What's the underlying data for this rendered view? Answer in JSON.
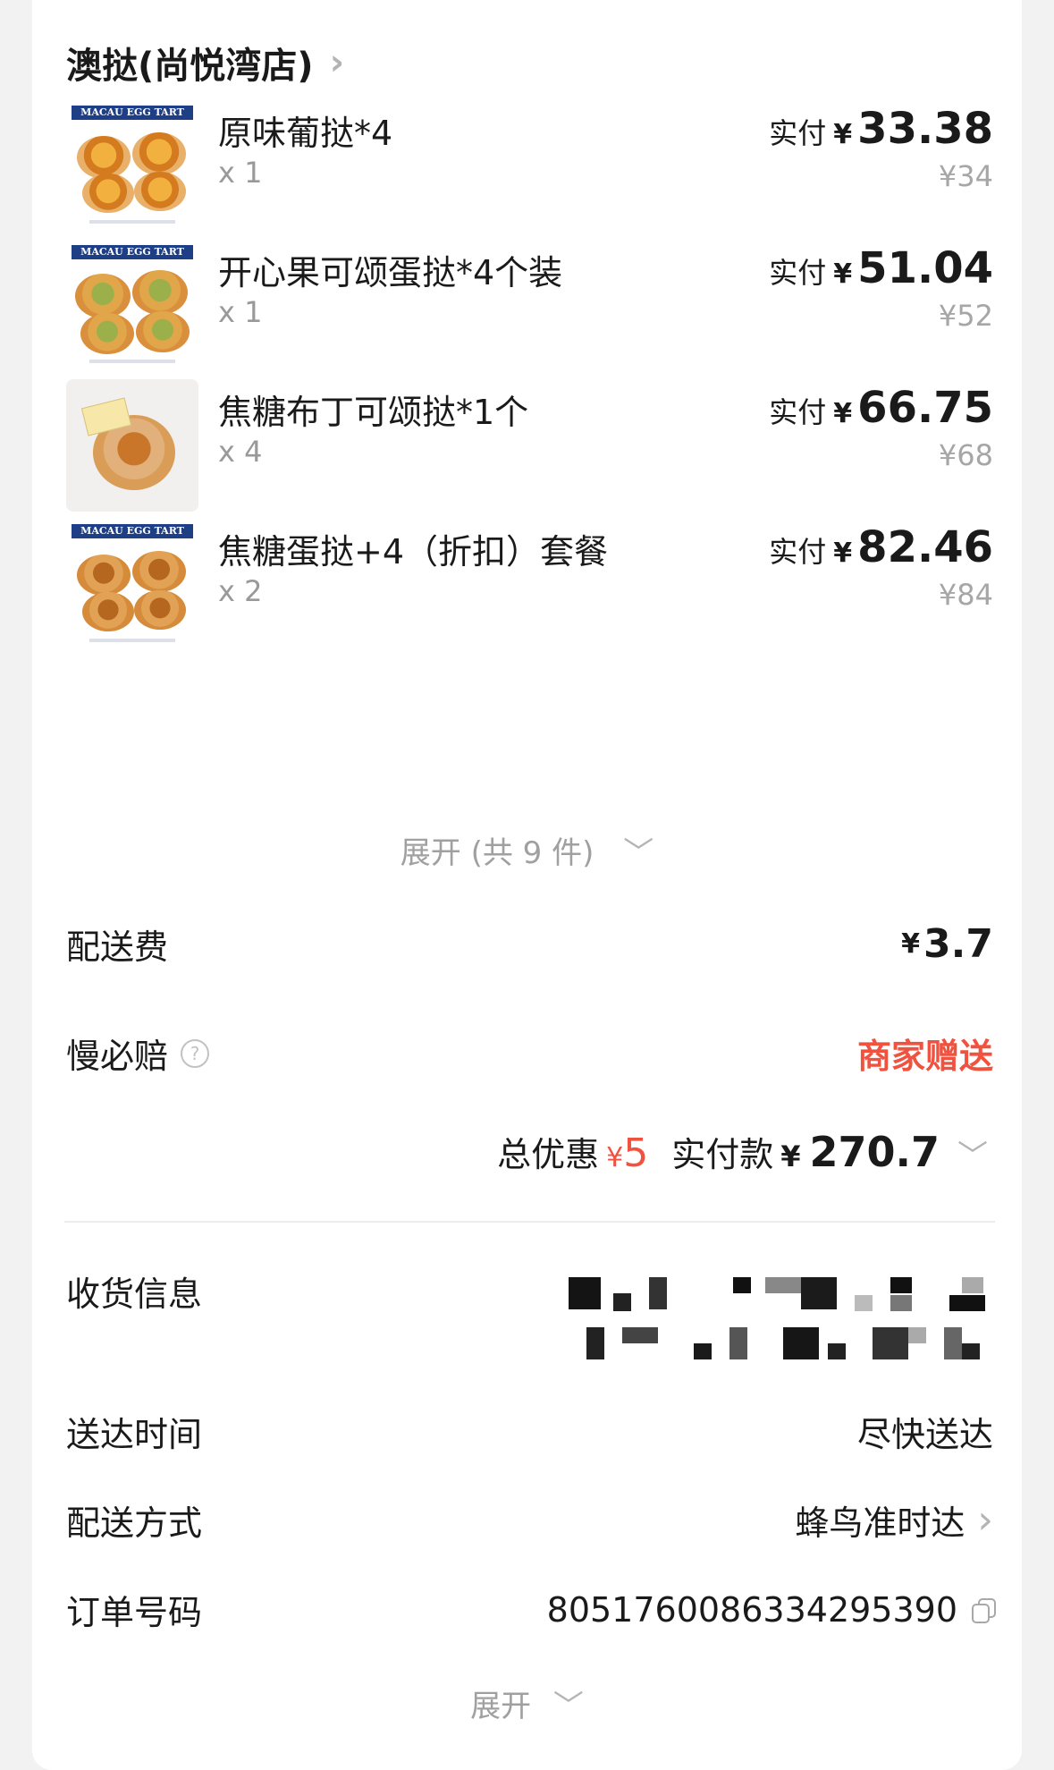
{
  "shop": {
    "name": "澳挞(尚悦湾店)",
    "chevron": "›"
  },
  "items": [
    {
      "thumb_label": "MACAU EGG TART",
      "name": "原味葡挞*4",
      "qty": "x 1",
      "pay_label": "实付",
      "currency": "¥",
      "pay": "33.38",
      "orig": "¥34"
    },
    {
      "thumb_label": "MACAU EGG TART",
      "name": "开心果可颂蛋挞*4个装",
      "qty": "x 1",
      "pay_label": "实付",
      "currency": "¥",
      "pay": "51.04",
      "orig": "¥52"
    },
    {
      "thumb_label": "",
      "name": "焦糖布丁可颂挞*1个",
      "qty": "x 4",
      "pay_label": "实付",
      "currency": "¥",
      "pay": "66.75",
      "orig": "¥68"
    },
    {
      "thumb_label": "MACAU EGG TART",
      "name": "焦糖蛋挞+4（折扣）套餐",
      "qty": "x 2",
      "pay_label": "实付",
      "currency": "¥",
      "pay": "82.46",
      "orig": "¥84"
    }
  ],
  "expand_items": "展开 (共 9 件)",
  "delivery_fee": {
    "label": "配送费",
    "currency": "¥",
    "value": "3.7"
  },
  "slow_guarantee": {
    "label": "慢必赔",
    "help": "?",
    "value": "商家赠送"
  },
  "summary": {
    "discount_label": "总优惠",
    "discount_currency": "¥",
    "discount": "5",
    "paid_label": "实付款",
    "paid_currency": "¥",
    "paid": "270.7"
  },
  "info": {
    "receiver_label": "收货信息",
    "time_label": "送达时间",
    "time_value": "尽快送达",
    "method_label": "配送方式",
    "method_value": "蜂鸟准时达",
    "order_label": "订单号码",
    "order_value": "8051760086334295390"
  },
  "expand_more": "展开",
  "icons": {
    "shop_chevron": "chevron-right-icon",
    "expand_chevron": "chevron-down-icon",
    "copy": "copy-icon",
    "help": "question-circle-icon"
  },
  "colors": {
    "accent_red": "#f0523f",
    "muted": "#a6a6a6",
    "brand_blue": "#1e3f86"
  }
}
